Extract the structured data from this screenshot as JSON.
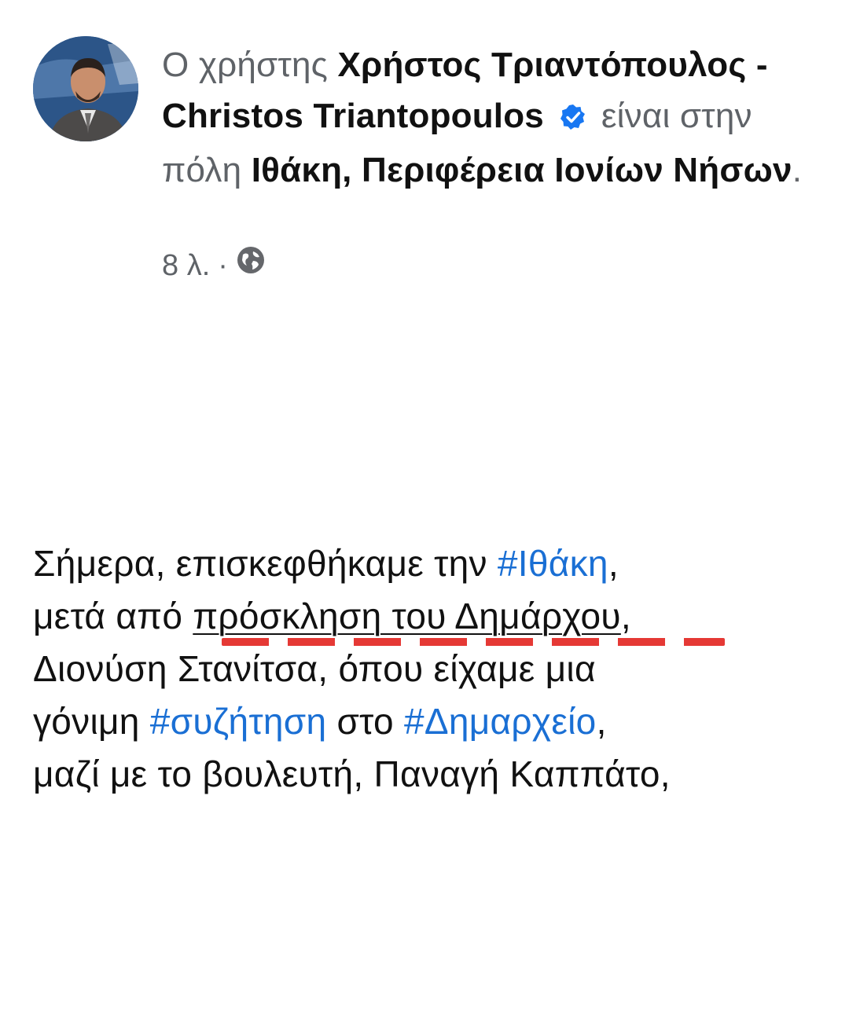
{
  "post_header": {
    "prefix": "Ο χρήστης",
    "author_name": "Χρήστος Τριαντόπουλος - Christos Triantopoulos",
    "location_prefix": "είναι στην πόλη",
    "location": "Ιθάκη, Περιφέρεια Ιονίων Νήσων",
    "end_dot": ".",
    "timestamp": "8 λ.",
    "separator": "·",
    "privacy_icon": "globe-icon",
    "verified_icon": "verified-badge-icon",
    "verified_color": "#1877f2"
  },
  "post_body": {
    "line1_text": "Σήμερα, επισκεφθήκαμε την ",
    "hashtag1": "#Ιθάκη",
    "line1_end": ",",
    "line2_start": "μετά από ",
    "line2_underlined": "πρόσκληση του Δημάρχου",
    "line2_end": ",",
    "line3": "Διονύση Στανίτσα, όπου είχαμε μια",
    "line4_start": "γόνιμη ",
    "hashtag2": "#συζήτηση",
    "line4_mid": " στο ",
    "hashtag3": "#Δημαρχείο",
    "line4_end": ",",
    "line5": "μαζί με το βουλευτή, Παναγή Καππάτο,",
    "hashtag_color": "#1a6fd4",
    "highlight_color": "#e53935"
  }
}
